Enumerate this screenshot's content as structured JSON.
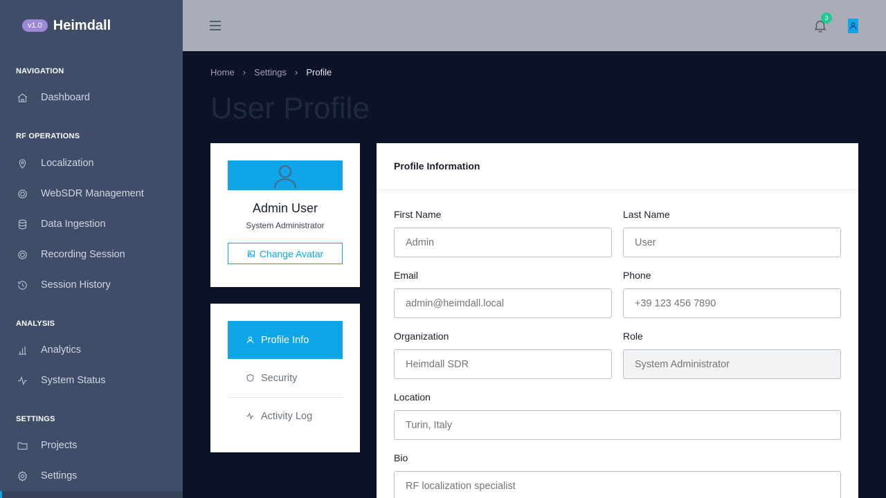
{
  "brand": {
    "version": "v1.0",
    "name": "Heimdall"
  },
  "sidebar": {
    "sections": [
      {
        "title": "NAVIGATION",
        "items": [
          {
            "label": "Dashboard",
            "icon": "home-icon"
          }
        ]
      },
      {
        "title": "RF OPERATIONS",
        "items": [
          {
            "label": "Localization",
            "icon": "map-pin-icon"
          },
          {
            "label": "WebSDR Management",
            "icon": "radio-icon"
          },
          {
            "label": "Data Ingestion",
            "icon": "database-icon"
          },
          {
            "label": "Recording Session",
            "icon": "record-icon"
          },
          {
            "label": "Session History",
            "icon": "history-icon"
          }
        ]
      },
      {
        "title": "ANALYSIS",
        "items": [
          {
            "label": "Analytics",
            "icon": "bar-chart-icon"
          },
          {
            "label": "System Status",
            "icon": "activity-icon"
          }
        ]
      },
      {
        "title": "SETTINGS",
        "items": [
          {
            "label": "Projects",
            "icon": "folder-icon"
          },
          {
            "label": "Settings",
            "icon": "gear-icon"
          }
        ]
      }
    ]
  },
  "topbar": {
    "notification_count": "3"
  },
  "breadcrumb": {
    "home": "Home",
    "settings": "Settings",
    "current": "Profile"
  },
  "page": {
    "title": "User Profile"
  },
  "profile_card": {
    "name": "Admin User",
    "role": "System Administrator",
    "change_avatar": "Change Avatar"
  },
  "profile_menu": {
    "items": [
      "Profile Info",
      "Security",
      "Activity Log"
    ],
    "active": "Profile Info"
  },
  "form": {
    "title": "Profile Information",
    "fields": {
      "first_name": {
        "label": "First Name",
        "placeholder": "Admin"
      },
      "last_name": {
        "label": "Last Name",
        "placeholder": "User"
      },
      "email": {
        "label": "Email",
        "placeholder": "admin@heimdall.local"
      },
      "phone": {
        "label": "Phone",
        "placeholder": "+39 123 456 7890"
      },
      "organization": {
        "label": "Organization",
        "placeholder": "Heimdall SDR"
      },
      "role": {
        "label": "Role",
        "placeholder": "System Administrator",
        "readonly": true
      },
      "location": {
        "label": "Location",
        "placeholder": "Turin, Italy"
      },
      "bio": {
        "label": "Bio",
        "placeholder": "RF localization specialist"
      }
    }
  },
  "colors": {
    "accent": "#0ea5e9",
    "sidebar_bg": "#3f4d68",
    "topbar_bg": "#a9adb7",
    "page_bg": "#0c1329",
    "badge": "#22c997",
    "version_pill": "#9d88d6"
  }
}
